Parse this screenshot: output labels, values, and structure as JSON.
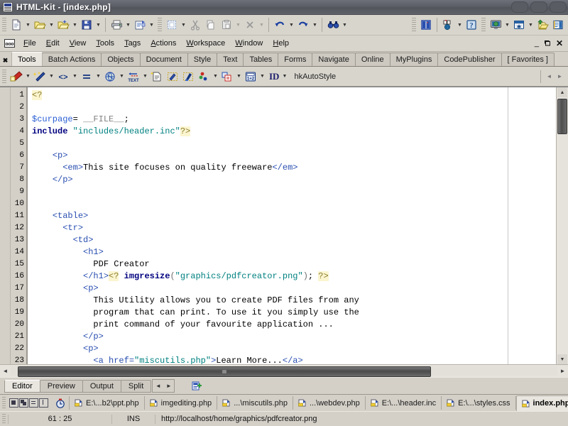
{
  "window": {
    "title": "HTML-Kit - [index.php]",
    "icon": "html-kit-app-icon",
    "buttons": [
      "minimize",
      "restore",
      "close"
    ]
  },
  "menubar": {
    "app_icon": "html-kit-menu-icon",
    "items": [
      "File",
      "Edit",
      "View",
      "Tools",
      "Tags",
      "Actions",
      "Workspace",
      "Window",
      "Help"
    ],
    "window_controls": [
      "minimize",
      "restore",
      "close"
    ]
  },
  "toolbar_main": {
    "groups": [
      {
        "items": [
          {
            "name": "new-file-icon",
            "dropdown": true
          },
          {
            "name": "open-file-icon",
            "dropdown": true
          },
          {
            "name": "open-workspace-icon",
            "dropdown": true
          },
          {
            "name": "save-file-icon",
            "dropdown": true
          }
        ]
      },
      {
        "items": [
          {
            "name": "print-icon",
            "dropdown": true
          },
          {
            "name": "print-preview-icon",
            "dropdown": true
          }
        ]
      },
      {
        "items": [
          {
            "name": "select-all-icon",
            "dropdown": true
          },
          {
            "name": "cut-icon",
            "dropdown": false
          },
          {
            "name": "copy-icon",
            "dropdown": false
          },
          {
            "name": "paste-icon",
            "dropdown": true
          },
          {
            "name": "delete-icon",
            "dropdown": true
          }
        ]
      },
      {
        "items": [
          {
            "name": "undo-icon",
            "dropdown": true
          },
          {
            "name": "redo-icon",
            "dropdown": true
          },
          {
            "name": "find-icon",
            "dropdown": true
          }
        ]
      },
      {
        "items": [
          {
            "name": "split-view-icon",
            "dropdown": false
          },
          {
            "name": "preview-browser-icon",
            "dropdown": true
          },
          {
            "name": "help-icon",
            "dropdown": false
          }
        ]
      },
      {
        "items": [
          {
            "name": "preview-monitor-icon",
            "dropdown": true
          },
          {
            "name": "window-settings-icon",
            "dropdown": true
          },
          {
            "name": "upload-ftp-icon",
            "dropdown": false
          },
          {
            "name": "file-manager-icon",
            "dropdown": false
          }
        ]
      }
    ]
  },
  "tabstrip": {
    "close_label": "✖",
    "tabs": [
      "Tools",
      "Batch Actions",
      "Objects",
      "Document",
      "Style",
      "Text",
      "Tables",
      "Forms",
      "Navigate",
      "Online",
      "MyPlugins",
      "CodePublisher",
      "[ Favorites ]"
    ],
    "active": "Tools"
  },
  "toolbar_tools": {
    "items": [
      {
        "name": "cleanup-tool-icon",
        "dropdown": true
      },
      {
        "name": "format-wand-icon",
        "dropdown": true
      },
      {
        "name": "code-tags-icon",
        "dropdown": true
      },
      {
        "name": "indent-lines-icon",
        "dropdown": true
      },
      {
        "name": "web-globe-icon",
        "dropdown": true
      },
      {
        "name": "wrap-text-icon",
        "dropdown": true
      },
      {
        "name": "new-document-icon",
        "dropdown": false
      },
      {
        "name": "edit-selection-icon",
        "dropdown": false
      },
      {
        "name": "highlight-selection-icon",
        "dropdown": false
      },
      {
        "name": "color-picker-icon",
        "dropdown": true
      },
      {
        "name": "copy-tag-icon",
        "dropdown": true
      },
      {
        "name": "calculator-icon",
        "dropdown": true
      }
    ],
    "id_label": "ID",
    "id_dropdown": true,
    "autostyle_value": "hkAutoStyle",
    "nav_prev": "◄",
    "nav_next": "►"
  },
  "editor": {
    "line_numbers": [
      "1",
      "2",
      "3",
      "4",
      "5",
      "6",
      "7",
      "8",
      "9",
      "10",
      "11",
      "12",
      "13",
      "14",
      "15",
      "16",
      "17",
      "18",
      "19",
      "20",
      "21",
      "22",
      "23"
    ],
    "lines": [
      [
        {
          "t": "<?",
          "c": "s-php"
        }
      ],
      [],
      [
        {
          "t": "$curpage",
          "c": "s-var"
        },
        {
          "t": "= ",
          "c": "s-txt"
        },
        {
          "t": "__FILE__",
          "c": "s-const"
        },
        {
          "t": ";",
          "c": "s-txt"
        }
      ],
      [
        {
          "t": "include",
          "c": "s-kw"
        },
        {
          "t": " ",
          "c": "s-txt"
        },
        {
          "t": "\"includes/header.inc\"",
          "c": "s-str"
        },
        {
          "t": "?>",
          "c": "s-php"
        }
      ],
      [],
      [
        {
          "t": "    ",
          "c": "s-txt"
        },
        {
          "t": "<p>",
          "c": "s-tag"
        }
      ],
      [
        {
          "t": "      ",
          "c": "s-txt"
        },
        {
          "t": "<em>",
          "c": "s-tag"
        },
        {
          "t": "This site focuses on quality freeware",
          "c": "s-txt"
        },
        {
          "t": "</em>",
          "c": "s-tag"
        }
      ],
      [
        {
          "t": "    ",
          "c": "s-txt"
        },
        {
          "t": "</p>",
          "c": "s-tag"
        }
      ],
      [],
      [],
      [
        {
          "t": "    ",
          "c": "s-txt"
        },
        {
          "t": "<table>",
          "c": "s-tag"
        }
      ],
      [
        {
          "t": "      ",
          "c": "s-txt"
        },
        {
          "t": "<tr>",
          "c": "s-tag"
        }
      ],
      [
        {
          "t": "        ",
          "c": "s-txt"
        },
        {
          "t": "<td>",
          "c": "s-tag"
        }
      ],
      [
        {
          "t": "          ",
          "c": "s-txt"
        },
        {
          "t": "<h1>",
          "c": "s-tag"
        }
      ],
      [
        {
          "t": "            PDF Creator",
          "c": "s-txt"
        }
      ],
      [
        {
          "t": "          ",
          "c": "s-txt"
        },
        {
          "t": "</h1>",
          "c": "s-tag"
        },
        {
          "t": "<?",
          "c": "s-php"
        },
        {
          "t": " ",
          "c": "s-txt"
        },
        {
          "t": "imgresize",
          "c": "s-fn"
        },
        {
          "t": "(",
          "c": "s-punc"
        },
        {
          "t": "\"graphics/pdfcreator.png\"",
          "c": "s-str"
        },
        {
          "t": ")",
          "c": "s-punc"
        },
        {
          "t": "; ",
          "c": "s-txt"
        },
        {
          "t": "?>",
          "c": "s-php"
        }
      ],
      [
        {
          "t": "          ",
          "c": "s-txt"
        },
        {
          "t": "<p>",
          "c": "s-tag"
        }
      ],
      [
        {
          "t": "            This Utility allows you to create PDF files from any",
          "c": "s-txt"
        }
      ],
      [
        {
          "t": "            program that can print. To use it you simply use the",
          "c": "s-txt"
        }
      ],
      [
        {
          "t": "            print command of your favourite application ...",
          "c": "s-txt"
        }
      ],
      [
        {
          "t": "          ",
          "c": "s-txt"
        },
        {
          "t": "</p>",
          "c": "s-tag"
        }
      ],
      [
        {
          "t": "          ",
          "c": "s-txt"
        },
        {
          "t": "<p>",
          "c": "s-tag"
        }
      ],
      [
        {
          "t": "            ",
          "c": "s-txt"
        },
        {
          "t": "<a href=",
          "c": "s-tag"
        },
        {
          "t": "\"miscutils.php\"",
          "c": "s-str"
        },
        {
          "t": ">",
          "c": "s-tag"
        },
        {
          "t": "Learn More...",
          "c": "s-txt"
        },
        {
          "t": "</a>",
          "c": "s-tag"
        }
      ]
    ],
    "scroll_up": "▲",
    "scroll_down": "▼",
    "scroll_left": "◄",
    "scroll_right": "►"
  },
  "view_tabs": {
    "tabs": [
      "Editor",
      "Preview",
      "Output",
      "Split"
    ],
    "active": "Editor",
    "nav_prev": "◄",
    "nav_next": "►",
    "extra_icon": "add-snippet-icon"
  },
  "file_tabs": {
    "mini_buttons": [
      "window-tile-icon",
      "window-cascade-icon",
      "window-list-icon",
      "window-split-icon"
    ],
    "clock_icon": "recent-files-icon",
    "tabs": [
      {
        "label": "E:\\...b2\\ppt.php",
        "active": false
      },
      {
        "label": "imgediting.php",
        "active": false
      },
      {
        "label": "...\\miscutils.php",
        "active": false
      },
      {
        "label": "...\\webdev.php",
        "active": false
      },
      {
        "label": "E:\\...\\header.inc",
        "active": false
      },
      {
        "label": "E:\\...\\styles.css",
        "active": false
      },
      {
        "label": "index.php",
        "active": true
      }
    ]
  },
  "statusbar": {
    "cursor": "61 : 25",
    "insert_mode": "INS",
    "url": "http://localhost/home/graphics/pdfcreator.png"
  },
  "colors": {
    "titlebar": "#5c5e66",
    "chrome": "#d4d0c8",
    "toolbar": "#d8d5cd",
    "editor_bg": "#ffffff",
    "php_delim_bg": "#fbf5d0",
    "keyword": "#000080",
    "string": "#008080",
    "tag": "#2a4fb0",
    "variable": "#2a5fd4"
  }
}
